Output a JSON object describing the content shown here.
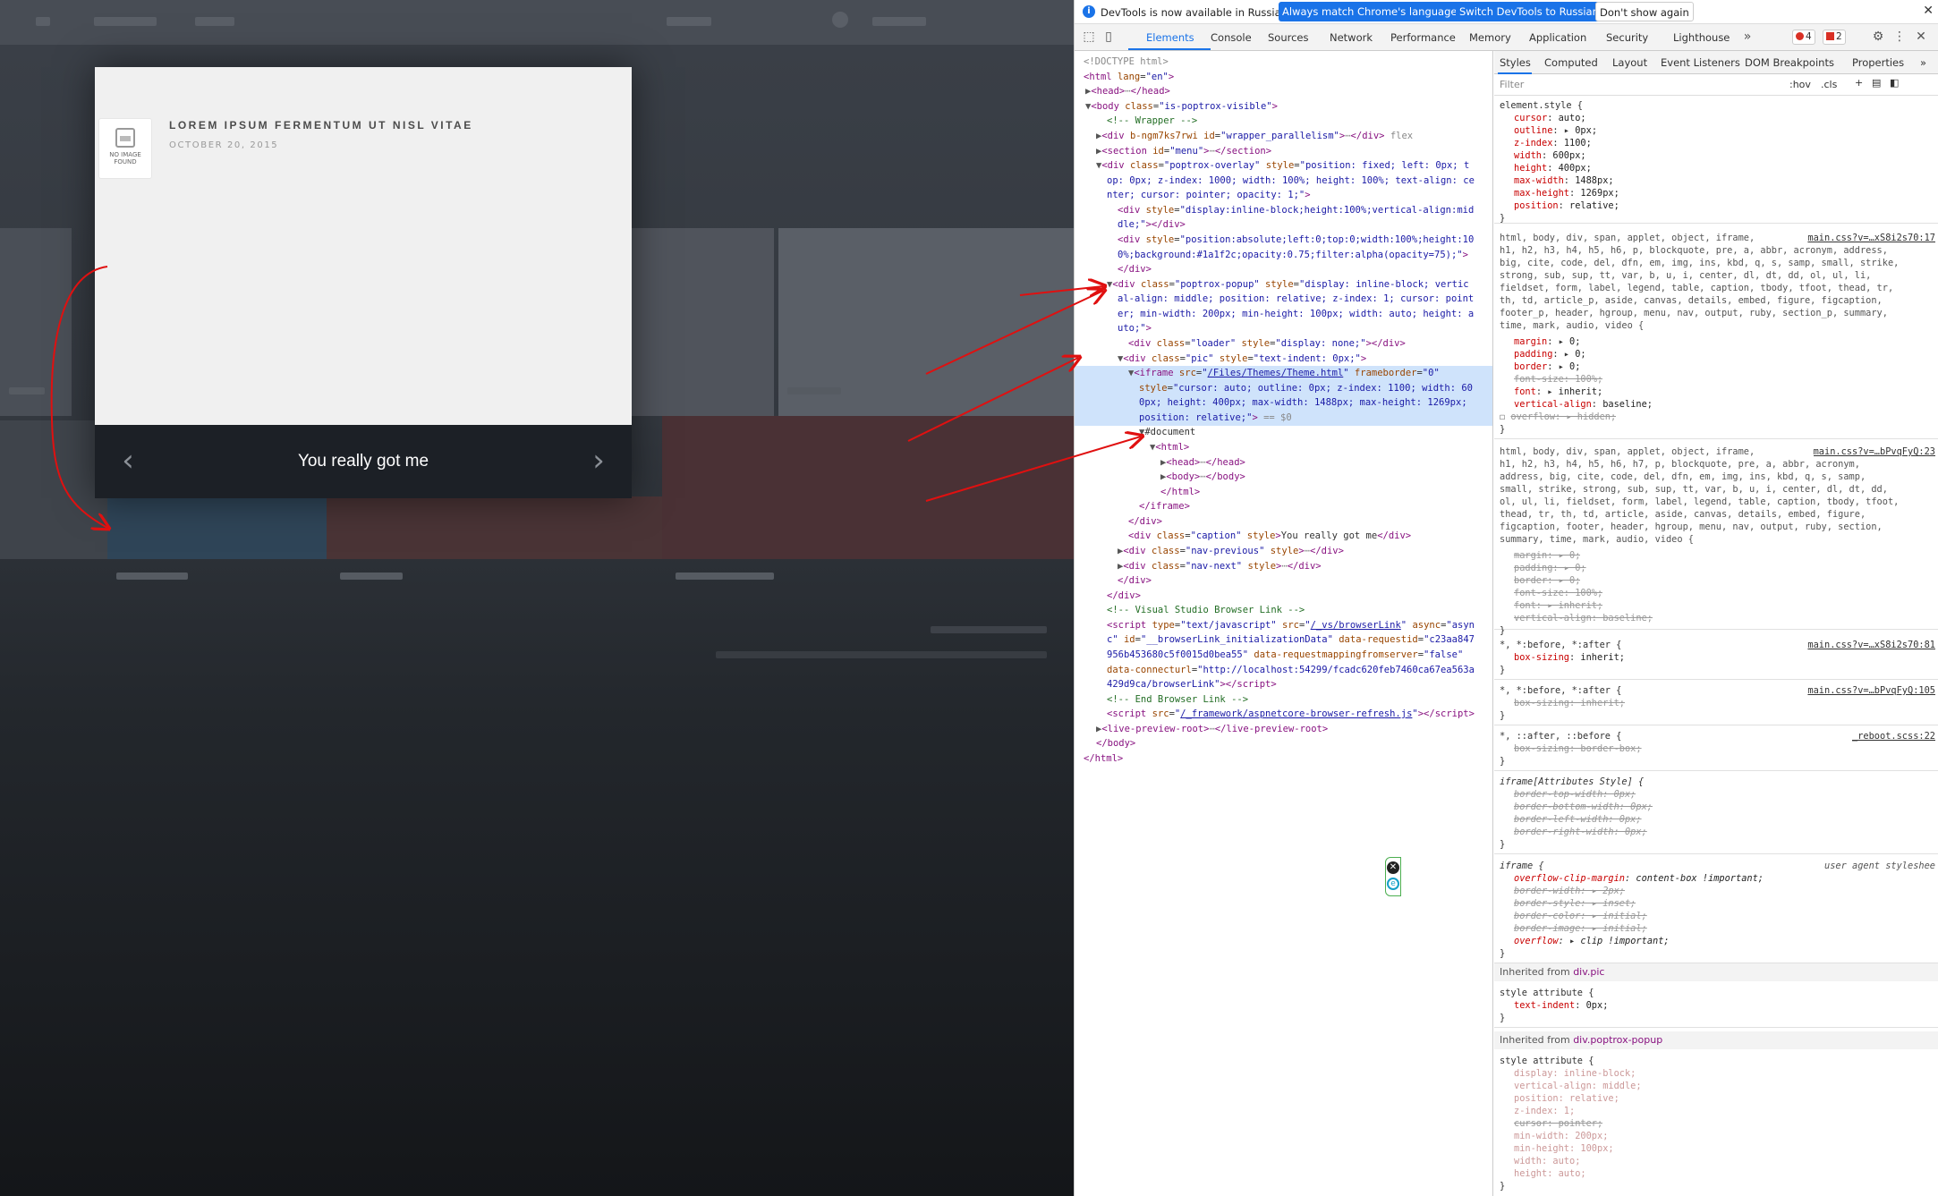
{
  "page": {
    "popup": {
      "noimage_label": "NO IMAGE FOUND",
      "post_title": "LOREM IPSUM FERMENTUM UT NISL VITAE",
      "post_date": "OCTOBER 20, 2015",
      "caption": "You really got me",
      "prev_icon": "chevron-left-icon",
      "next_icon": "chevron-right-icon"
    },
    "colors": {
      "overlay_bg": "#1a1f2c",
      "caption_bg": "#1c2026",
      "annotation_arrow": "#e01010"
    }
  },
  "devtools": {
    "infobar": {
      "text": "DevTools is now available in Russian!",
      "btn_match": "Always match Chrome's language",
      "btn_switch": "Switch DevTools to Russian",
      "btn_dismiss": "Don't show again"
    },
    "tabs": [
      "Elements",
      "Console",
      "Sources",
      "Network",
      "Performance",
      "Memory",
      "Application",
      "Security",
      "Lighthouse"
    ],
    "badges": {
      "errors": "4",
      "warnings": "2"
    },
    "styles_tabs": [
      "Styles",
      "Computed",
      "Layout",
      "Event Listeners",
      "DOM Breakpoints",
      "Properties"
    ],
    "filter_placeholder": "Filter",
    "hov": ":hov",
    "cls": ".cls",
    "inherited_pic": "Inherited from",
    "inherited_pic_el": "div.pic",
    "inherited_popup": "Inherited from",
    "inherited_popup_el": "div.poptrox-popup"
  }
}
